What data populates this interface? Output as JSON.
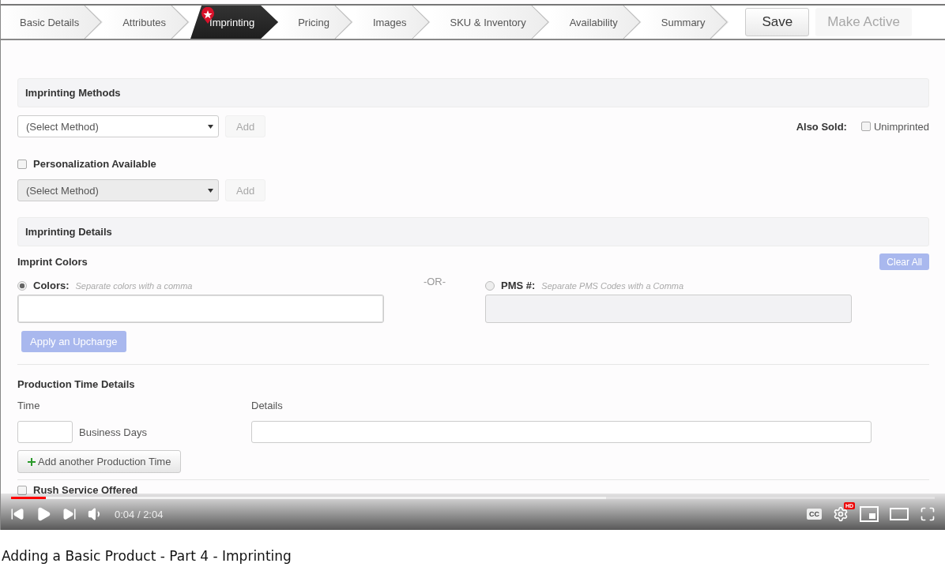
{
  "steps": [
    {
      "label": "Basic Details",
      "selected": false,
      "warning": false
    },
    {
      "label": "Attributes",
      "selected": false,
      "warning": false
    },
    {
      "label": "Imprinting",
      "selected": true,
      "warning": true
    },
    {
      "label": "Pricing",
      "selected": false,
      "warning": false
    },
    {
      "label": "Images",
      "selected": false,
      "warning": false
    },
    {
      "label": "SKU & Inventory",
      "selected": false,
      "warning": false
    },
    {
      "label": "Availability",
      "selected": false,
      "warning": false
    },
    {
      "label": "Summary",
      "selected": false,
      "warning": false
    }
  ],
  "actions": [
    {
      "label": "Save",
      "disabled": false
    },
    {
      "label": "Make Active",
      "disabled": true
    }
  ],
  "imprinting_methods": {
    "title": "Imprinting Methods",
    "select": {
      "value": "(Select Method)",
      "disabled": false
    },
    "add_button": {
      "label": "Add",
      "disabled": true
    },
    "also_sold": {
      "label": "Also Sold:",
      "option": {
        "label": "Unimprinted",
        "checked": false
      }
    }
  },
  "personalization": {
    "label": "Personalization Available",
    "checked": false,
    "select": {
      "value": "(Select Method)",
      "disabled": true
    },
    "add_button": {
      "label": "Add",
      "disabled": true
    }
  },
  "imprinting_details": {
    "title": "Imprinting Details",
    "subtitle": "Imprint Colors",
    "clear_button": {
      "label": "Clear All",
      "disabled": true
    },
    "options": [
      {
        "label": "Colors:",
        "hint": "Separate colors with a comma",
        "selected": true
      },
      {
        "label": "PMS #:",
        "hint": "Separate PMS Codes with a Comma",
        "selected": false
      }
    ],
    "separator": "-OR-",
    "upcharge_button": {
      "label": "Apply an Upcharge",
      "disabled": true
    }
  },
  "production_time": {
    "title": "Production Time Details",
    "time_label": "Time",
    "details_label": "Details",
    "unit": "Business Days",
    "add_button": "Add another Production Time"
  },
  "rush_service": {
    "label": "Rush Service Offered",
    "checked": false
  },
  "player": {
    "progress": {
      "level": 0.038
    },
    "buffered": {
      "level": 0.644
    },
    "time": "0:04 / 2:04",
    "cc": "CC",
    "hd_badge": "HD"
  },
  "video_title": "Adding a Basic Product - Part 4 - Imprinting"
}
